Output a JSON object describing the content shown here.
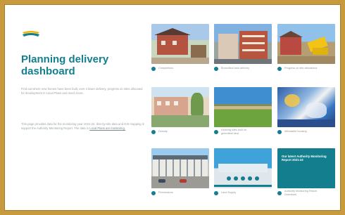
{
  "page": {
    "title": "Planning delivery dashboard",
    "intro": "Find out where new homes have been built, over 4 lower delivery, progress on sites allocated for development in Local Plans and much more.",
    "secondary_pre": "This page provides data for the monitoring year 2021-22. Site-by-site data and GIS mapping is support the Authority Monitoring Report. The data in",
    "secondary_link": "Local Plans are monitoring.",
    "colors": {
      "accent": "#137f8e",
      "frame": "#c79a3d"
    }
  },
  "tiles": [
    {
      "label": "Completions"
    },
    {
      "label": "Brownfield land delivery"
    },
    {
      "label": "Progress on site allocations"
    },
    {
      "label": "Density"
    },
    {
      "label": "Housing sites built on\ngreenfield land"
    },
    {
      "label": "Affordable housing"
    },
    {
      "label": "Permissions"
    },
    {
      "label": "Land Supply"
    },
    {
      "label": "Authority Monitoring Report\nDownload"
    }
  ],
  "banner": {
    "text": "Our latest Authority Monitoring Report 2021-22"
  }
}
